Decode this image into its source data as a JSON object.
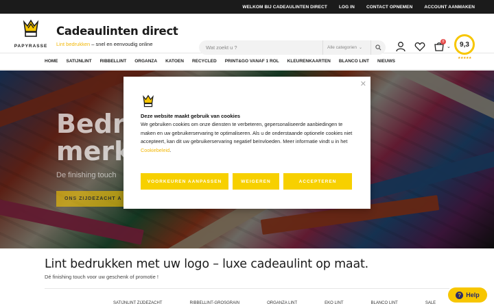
{
  "topbar": {
    "links": [
      "WELKOM BIJ CADEAULINTEN DIRECT",
      "LOG IN",
      "CONTACT OPNEMEN",
      "ACCOUNT AANMAKEN"
    ]
  },
  "header": {
    "brand": "PAPYRASSE",
    "site_title": "Cadeaulinten direct",
    "tagline_highlight": "Lint bedrukken",
    "tagline_rest": " – snel en eenvoudig online",
    "search_placeholder": "Wat zoekt u ?",
    "search_category": "Alle categorien",
    "cart_count": "0",
    "rating_score": "9,3",
    "rating_stars": "★★★★★",
    "colors": {
      "accent": "#f2b705",
      "topbar": "#1b1b1b"
    }
  },
  "nav": {
    "items": [
      "HOME",
      "SATIJNLINT",
      "RIBBELLINT",
      "ORGANZA",
      "KATOEN",
      "RECYCLED",
      "PRINT&GO VANAF 1 ROL",
      "KLEURENKAARTEN",
      "BLANCO LINT",
      "NIEUWS"
    ]
  },
  "hero": {
    "title_line1": "Bedru",
    "title_line2": "merkl",
    "subtitle": "De finishing touch",
    "button": "ONS ZIJDEZACHT A"
  },
  "cookie_modal": {
    "title": "Deze website maakt gebruik van cookies",
    "text": "We gebruiken cookies om onze diensten te verbeteren, gepersonaliseerde aanbiedingen te maken en uw gebruikerservaring te optimaliseren. Als u de onderstaande optionele cookies niet accepteert, kan dit uw gebruikerservaring negatief beïnvloeden. Meer informatie vindt u in het ",
    "link": "Cookiebeleid",
    "text_end": ".",
    "btn_preferences": "VOORKEUREN AANPASSEN",
    "btn_refuse": "WEIGEREN",
    "btn_accept": "ACCEPTEREN"
  },
  "main": {
    "headline": "Lint bedrukken met uw logo – luxe cadeaulint op maat.",
    "subline": "Dé finishing touch voor uw geschenk of promotie !"
  },
  "bottom_nav": {
    "items": [
      "SATIJNLINT ZIJDEZACHT",
      "RIBBELLINT-GROSGRAIN",
      "ORGANZA LINT",
      "EKO LINT",
      "BLANCO LINT",
      "SALE"
    ]
  },
  "help": {
    "label": "Help"
  }
}
